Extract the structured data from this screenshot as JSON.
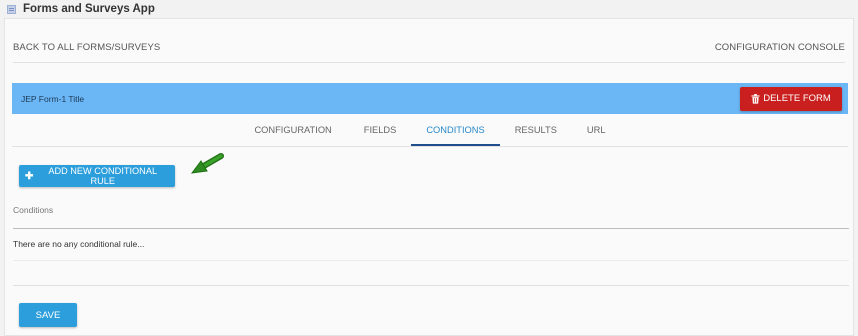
{
  "app": {
    "title": "Forms and Surveys App",
    "icon": "app-window-icon"
  },
  "top_bar": {
    "back_link": "BACK TO ALL FORMS/SURVEYS",
    "console_link": "CONFIGURATION CONSOLE"
  },
  "form": {
    "title": "JEP Form-1 Title",
    "delete_label": "DELETE FORM",
    "delete_icon": "trash-icon"
  },
  "tabs": [
    {
      "label": "CONFIGURATION",
      "active": false
    },
    {
      "label": "FIELDS",
      "active": false
    },
    {
      "label": "CONDITIONS",
      "active": true
    },
    {
      "label": "RESULTS",
      "active": false
    },
    {
      "label": "URL",
      "active": false
    }
  ],
  "conditions": {
    "add_label": "ADD NEW CONDITIONAL RULE",
    "add_icon": "plus-icon",
    "section_label": "Conditions",
    "empty_message": "There are no any conditional rule..."
  },
  "save_label": "SAVE",
  "colors": {
    "form_bar": "#6bb6f5",
    "delete_button": "#c9201f",
    "primary_button": "#2b9edb",
    "active_tab": "#2789c8",
    "annotation_arrow": "#2e8b1f"
  }
}
